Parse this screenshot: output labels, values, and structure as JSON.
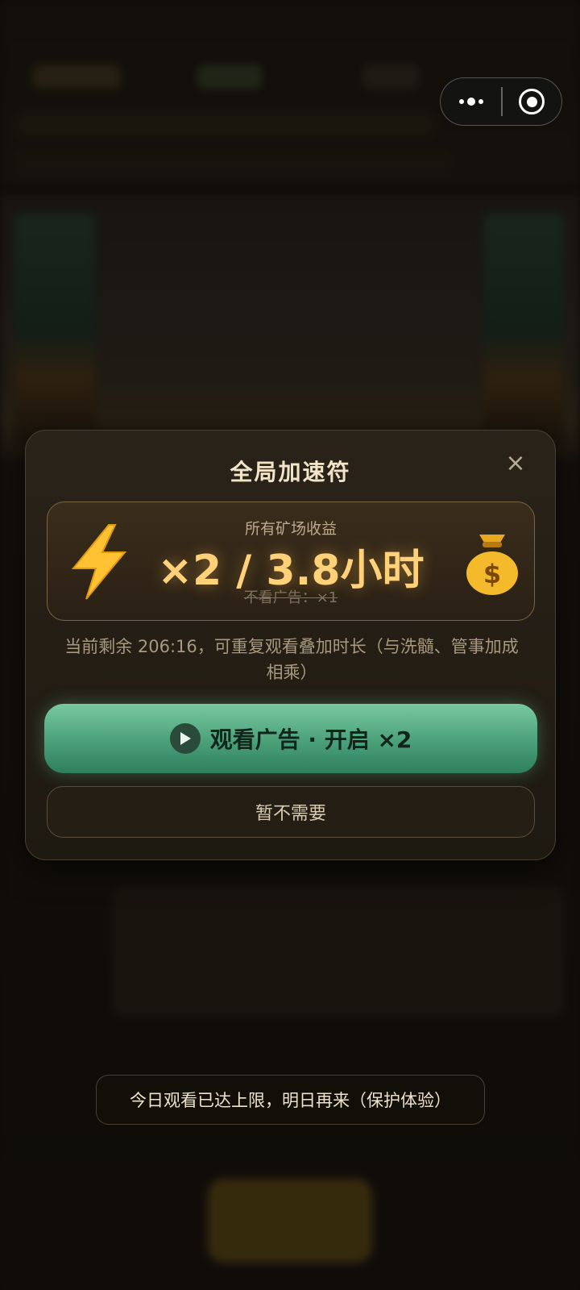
{
  "modal": {
    "title": "全局加速符",
    "close_icon": "×",
    "boost": {
      "subtitle": "所有矿场收益",
      "main": "×2 / 3.8小时",
      "note": "不看广告：×1",
      "left_icon": "lightning-icon",
      "right_icon": "money-bag-icon"
    },
    "remain_text": "当前剩余 206:16，可重复观看叠加时长（与洗髓、管事加成相乘）",
    "watch_button": "观看广告 · 开启 ×2",
    "skip_button": "暂不需要"
  },
  "toast": "今日观看已达上限，明日再来（保护体验）",
  "colors": {
    "accent_gold": "#ffd27a",
    "button_green": "#4aa07a",
    "modal_bg": "#241e15"
  }
}
